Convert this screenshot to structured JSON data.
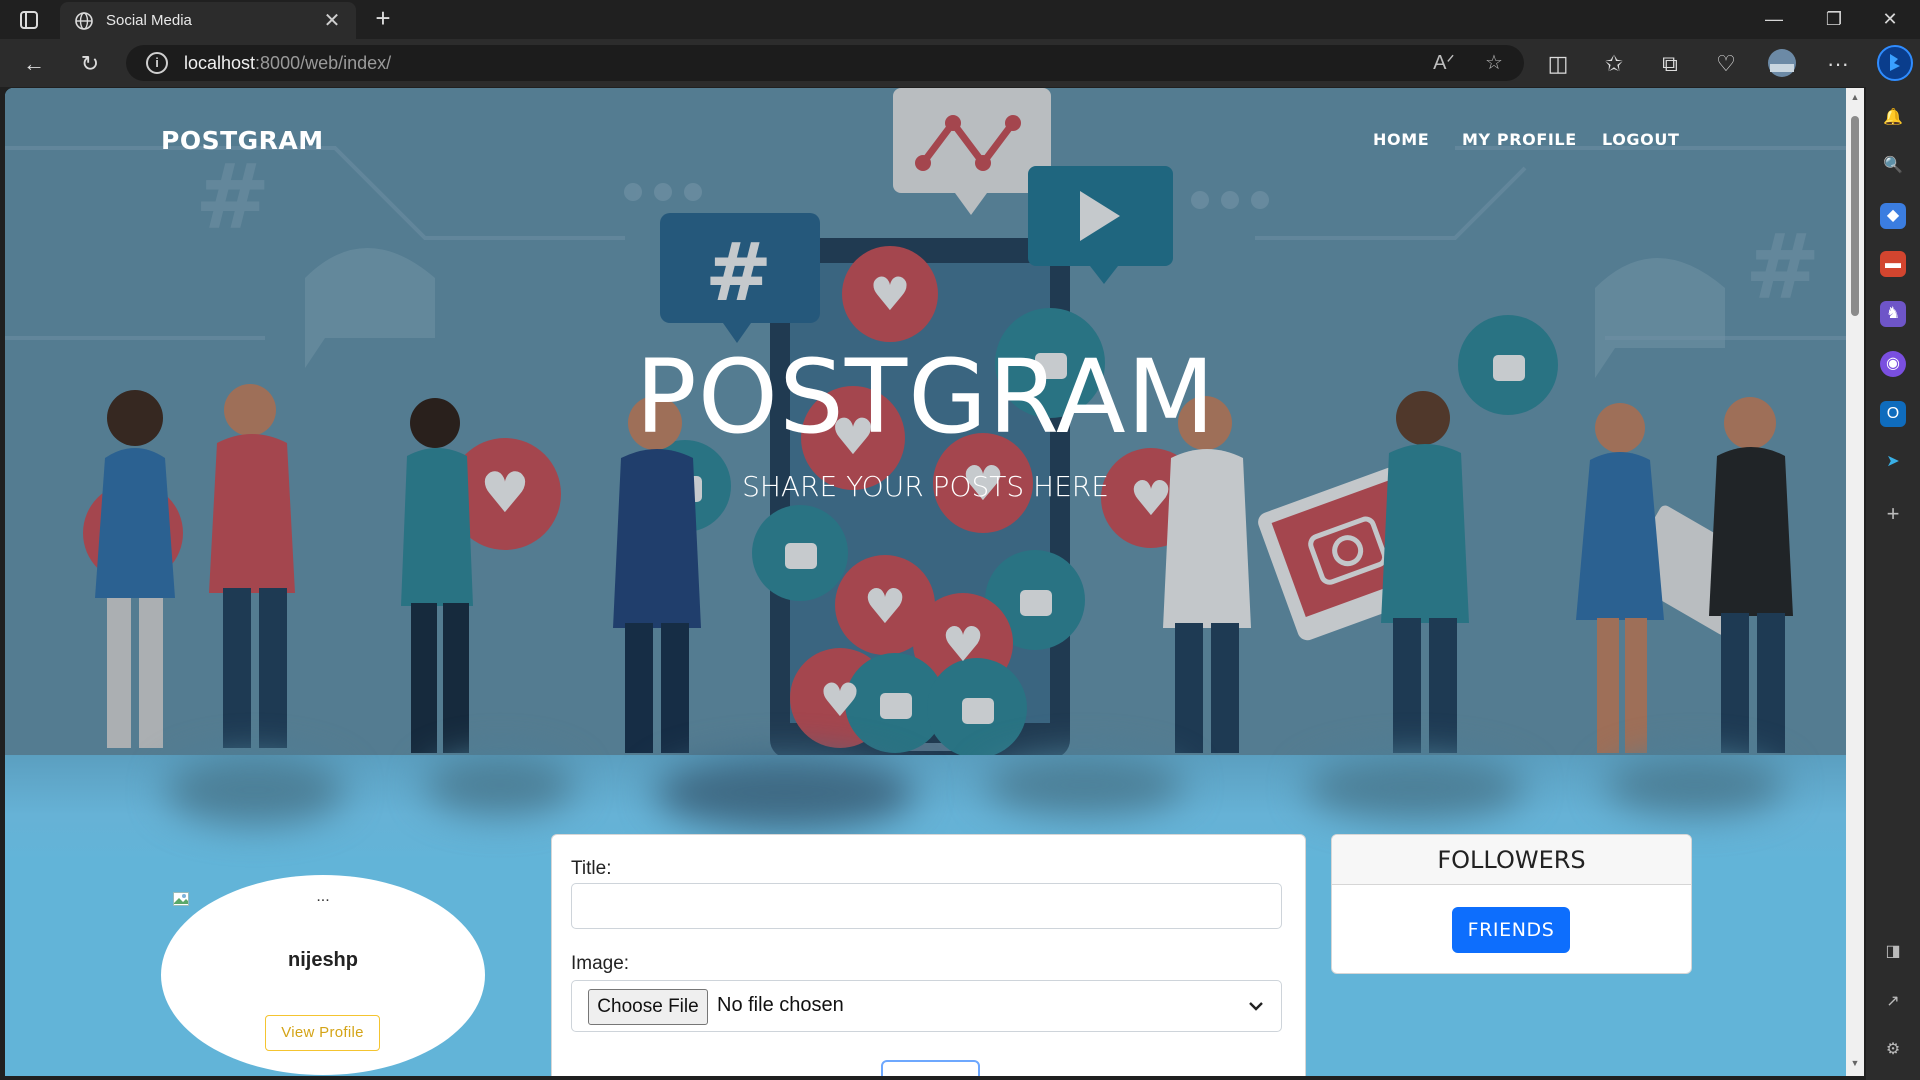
{
  "browser": {
    "tab_title": "Social Media",
    "url_host": "localhost",
    "url_path": ":8000/web/index/"
  },
  "site": {
    "brand": "POSTGRAM",
    "nav": [
      "HOME",
      "MY PROFILE",
      "LOGOUT"
    ],
    "hero_title": "POSTGRAM",
    "hero_subtitle": "SHARE YOUR POSTS HERE"
  },
  "profile": {
    "ellipsis": "...",
    "username": "nijeshp",
    "view_button": "View Profile"
  },
  "post_form": {
    "title_label": "Title:",
    "title_value": "",
    "image_label": "Image:",
    "choose_file": "Choose File",
    "no_file": "No file chosen"
  },
  "followers": {
    "heading": "FOLLOWERS",
    "friends_button": "FRIENDS"
  },
  "colors": {
    "hero_bg": "#5e8aa0",
    "page_bg": "#62b4d8",
    "primary": "#0d6efd",
    "warning": "#f4c430",
    "heart_red": "#c0484f",
    "thumb_teal": "#2a7f8f"
  }
}
